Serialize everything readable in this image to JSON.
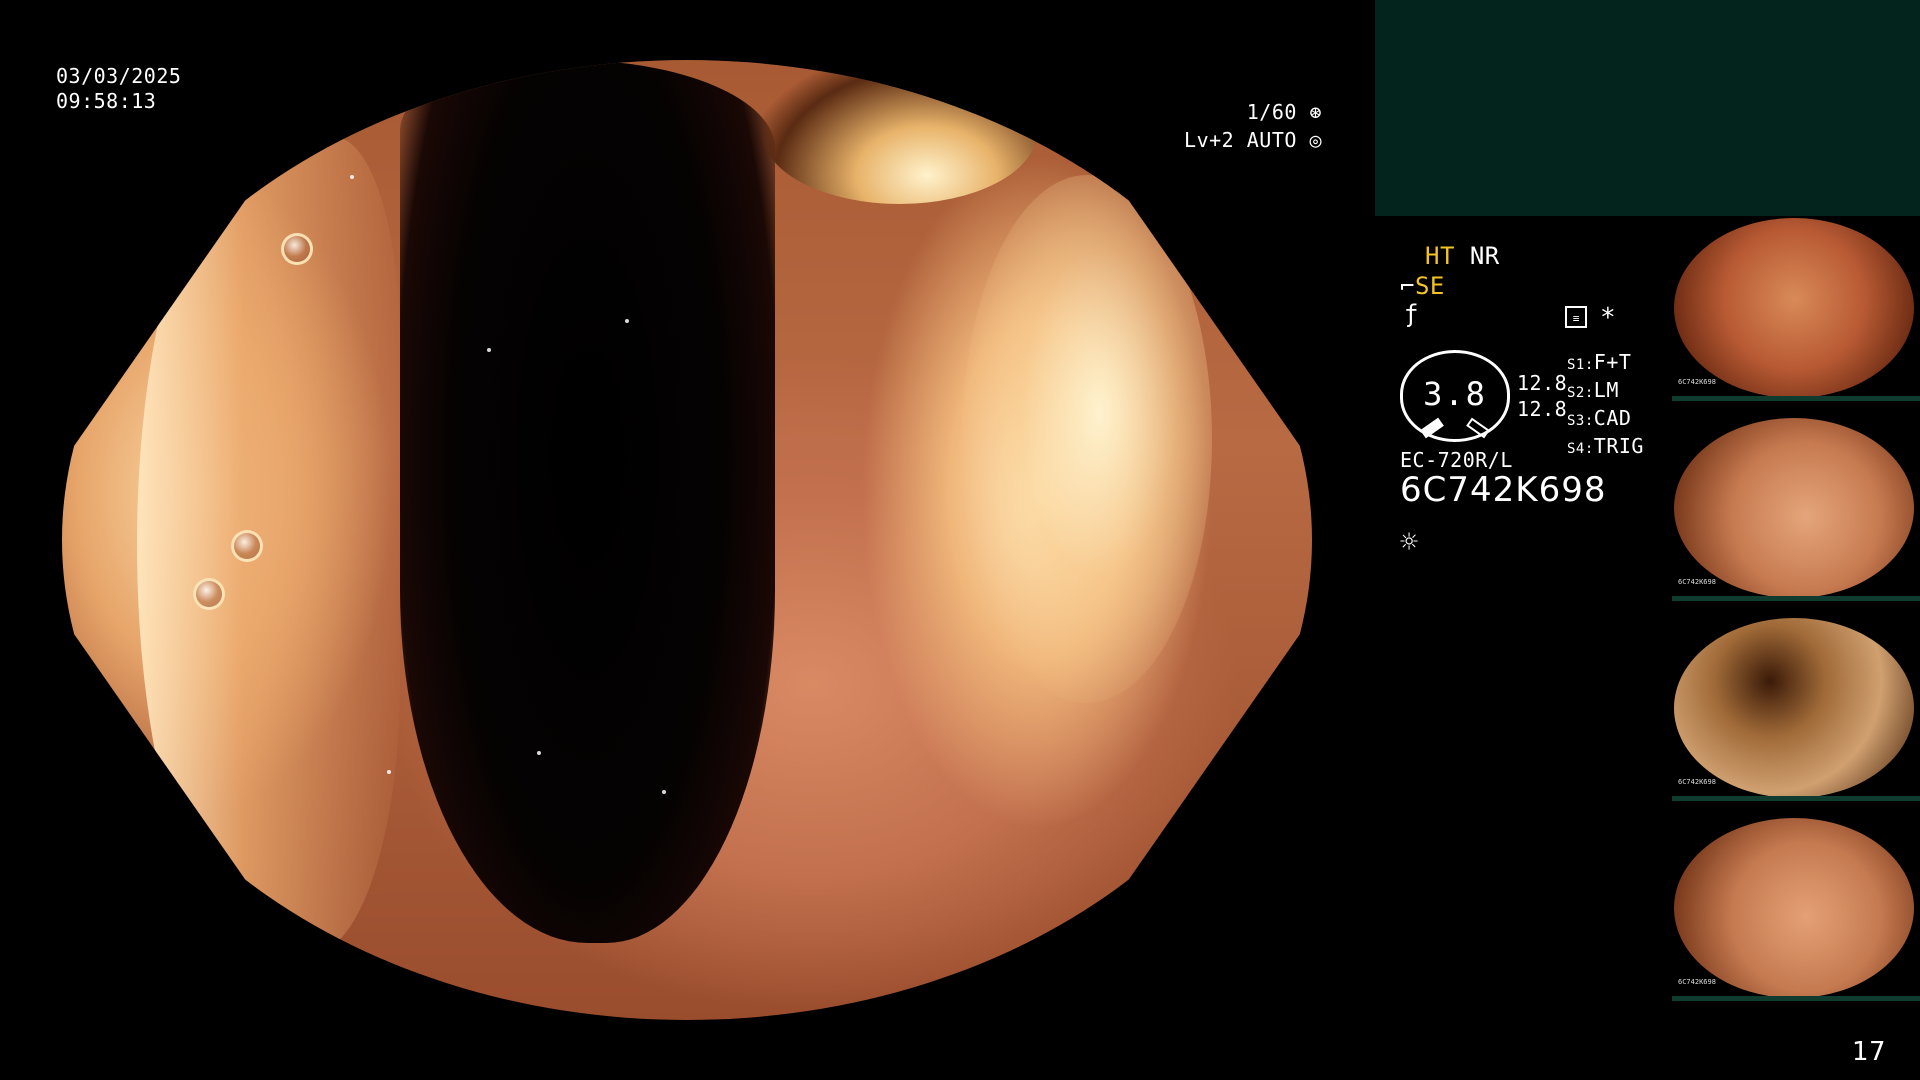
{
  "overlay": {
    "date": "03/03/2025",
    "time": "09:58:13",
    "shutter": "1/60",
    "shutter_icon": "aperture-icon",
    "level": "Lv+2 AUTO",
    "level_icon": "iris-icon"
  },
  "panel": {
    "ht": "HT",
    "nr": "NR",
    "se": "SE",
    "se_icon": "sword-icon",
    "f_icon": "f-hook-icon",
    "memo_icon": "memo-icon",
    "star": "*",
    "dial_value": "3.8",
    "val1": "12.8",
    "val2": "12.8",
    "slots": [
      {
        "key": "S1:",
        "val": "F+T"
      },
      {
        "key": "S2:",
        "val": "LM"
      },
      {
        "key": "S3:",
        "val": "CAD"
      },
      {
        "key": "S4:",
        "val": "TRIG"
      }
    ],
    "scope_model": "EC-720R/L",
    "serial": "6C742K698",
    "light_icon": "sun-icon"
  },
  "thumbnails": [
    {
      "label": "6C742K698"
    },
    {
      "label": "6C742K698"
    },
    {
      "label": "6C742K698"
    },
    {
      "label": "6C742K698"
    }
  ],
  "page_number": "17",
  "colors": {
    "accent_yellow": "#f3c325",
    "panel_green": "#02241c"
  }
}
